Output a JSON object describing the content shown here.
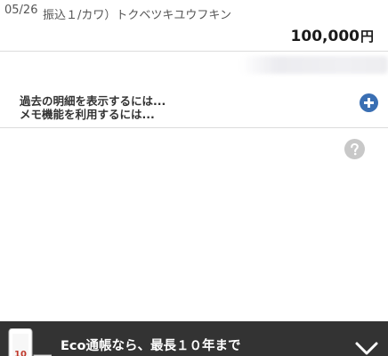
{
  "transaction": {
    "date": "05/26",
    "description": "振込１/カワ）トクベツキユウフキン",
    "amount": "100,000",
    "currency_unit": "円"
  },
  "info": {
    "past_details_link": "過去の明細を表示するには...",
    "memo_link": "メモ機能を利用するには..."
  },
  "banner": {
    "text": "Eco通帳なら、最長１０年まで",
    "graphic_number": "10",
    "close_icon": "chevron-down-icon"
  },
  "colors": {
    "plus_button": "#3a6fb3",
    "help_button": "#c8c8c8",
    "banner_bg": "#333333",
    "graphic_accent": "#c0392b"
  }
}
